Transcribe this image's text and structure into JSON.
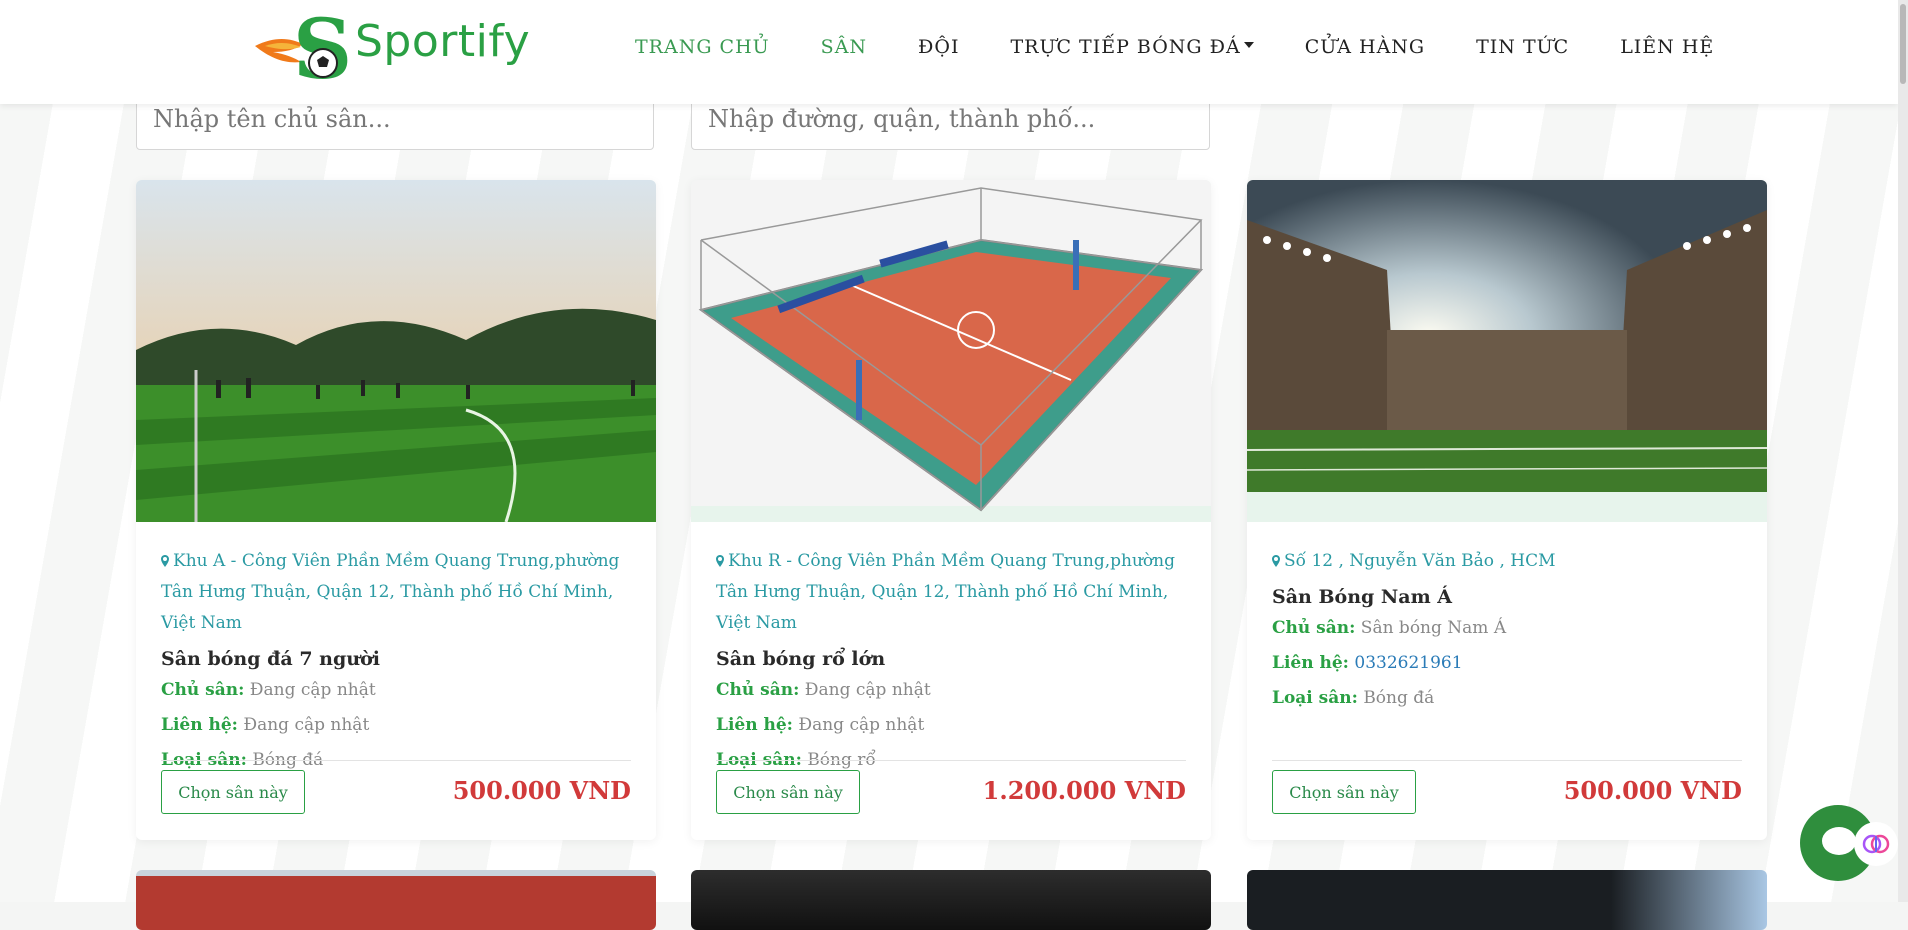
{
  "brand": {
    "name": "Sportify"
  },
  "nav": {
    "items": [
      {
        "label": "TRANG CHỦ"
      },
      {
        "label": "SÂN"
      },
      {
        "label": "ĐỘI"
      },
      {
        "label": "TRỰC TIẾP BÓNG ĐÁ"
      },
      {
        "label": "CỬA HÀNG"
      },
      {
        "label": "TIN TỨC"
      },
      {
        "label": "LIÊN HỆ"
      }
    ]
  },
  "search": {
    "owner_placeholder": "Nhập tên chủ sân...",
    "address_placeholder": "Nhập đường, quận, thành phố..."
  },
  "labels": {
    "owner": "Chủ sân:",
    "contact": "Liên hệ:",
    "type": "Loại sân:",
    "choose": "Chọn sân này"
  },
  "fields": [
    {
      "location": "Khu A - Công Viên Phần Mềm Quang Trung,phường Tân Hưng Thuận, Quận 12, Thành phố Hồ Chí Minh, Việt Nam",
      "name": "Sân bóng đá 7 người",
      "owner": "Đang cập nhật",
      "contact": "Đang cập nhật",
      "type": "Bóng đá",
      "price": "500.000 VND"
    },
    {
      "location": "Khu R - Công Viên Phần Mềm Quang Trung,phường Tân Hưng Thuận, Quận 12, Thành phố Hồ Chí Minh, Việt Nam",
      "name": "Sân bóng rổ lớn",
      "owner": "Đang cập nhật",
      "contact": "Đang cập nhật",
      "type": "Bóng rổ",
      "price": "1.200.000 VND"
    },
    {
      "location": "Số 12 , Nguyễn Văn Bảo , HCM",
      "name": "Sân Bóng Nam Á",
      "owner": "Sân bóng Nam Á",
      "contact": "0332621961",
      "type": "Bóng đá",
      "price": "500.000 VND"
    }
  ],
  "colors": {
    "brand_green": "#2aa044",
    "price_red": "#d13a3a",
    "location_teal": "#2a9aa3",
    "chat_green": "#2f8e3d"
  }
}
